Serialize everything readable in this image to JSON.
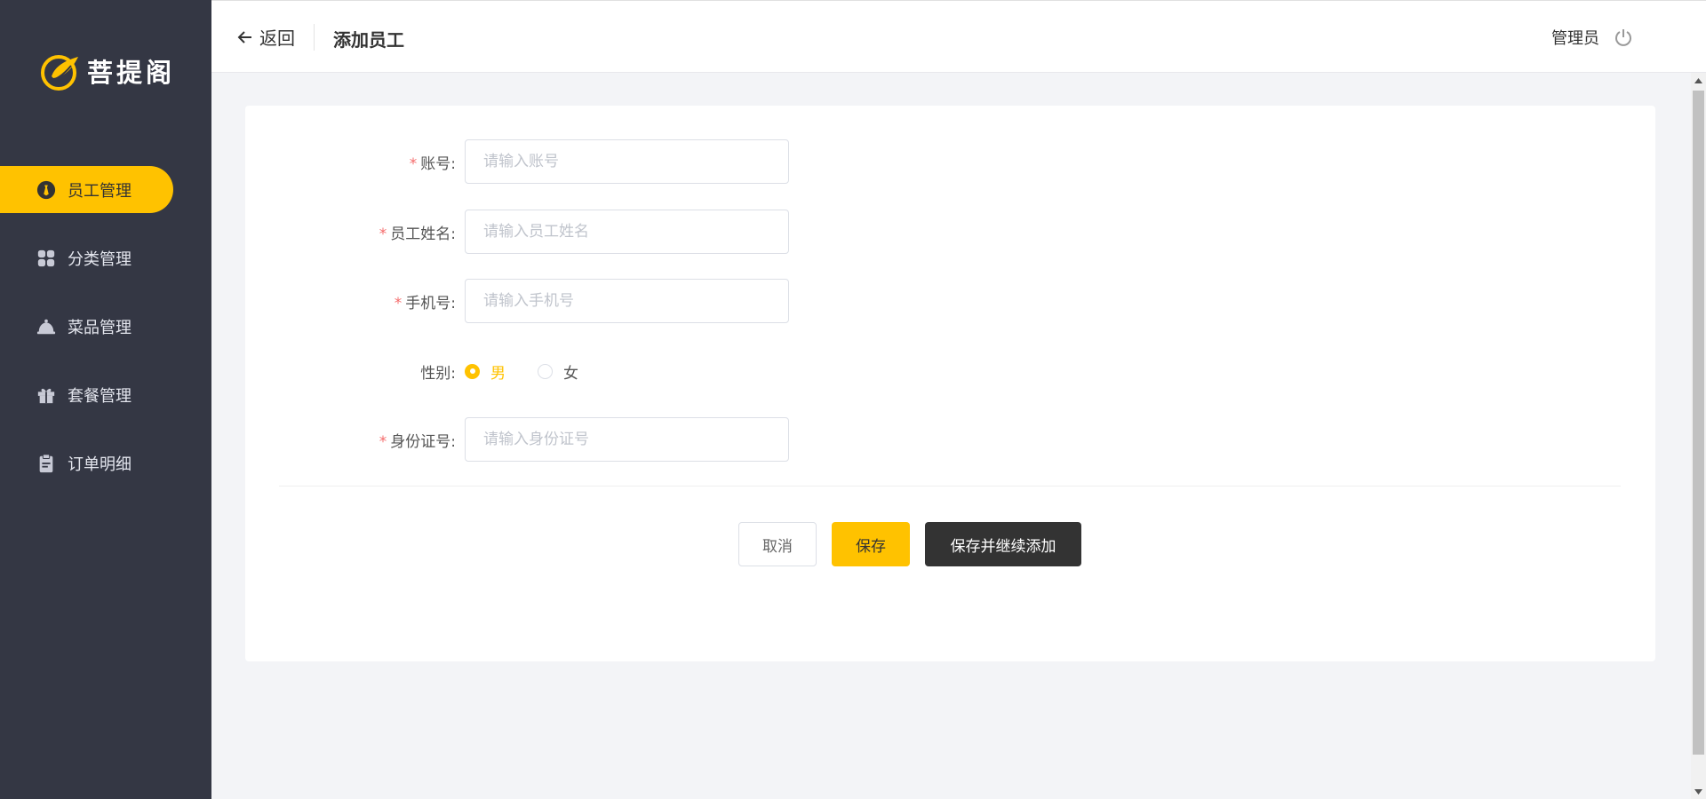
{
  "brand": {
    "name": "菩提阁"
  },
  "sidebar": {
    "items": [
      {
        "label": "员工管理",
        "icon": "employee-icon",
        "active": true
      },
      {
        "label": "分类管理",
        "icon": "category-grid-icon",
        "active": false
      },
      {
        "label": "菜品管理",
        "icon": "dish-cloche-icon",
        "active": false
      },
      {
        "label": "套餐管理",
        "icon": "gift-box-icon",
        "active": false
      },
      {
        "label": "订单明细",
        "icon": "clipboard-icon",
        "active": false
      }
    ]
  },
  "header": {
    "back_label": "返回",
    "title": "添加员工",
    "user_name": "管理员"
  },
  "form": {
    "account": {
      "label": "账号:",
      "placeholder": "请输入账号",
      "value": ""
    },
    "name": {
      "label": "员工姓名:",
      "placeholder": "请输入员工姓名",
      "value": ""
    },
    "phone": {
      "label": "手机号:",
      "placeholder": "请输入手机号",
      "value": ""
    },
    "gender": {
      "label": "性别:",
      "options": [
        "男",
        "女"
      ],
      "selected": "男"
    },
    "id_number": {
      "label": "身份证号:",
      "placeholder": "请输入身份证号",
      "value": ""
    },
    "required_mark": "*"
  },
  "buttons": {
    "cancel": "取消",
    "save": "保存",
    "save_continue": "保存并继续添加"
  },
  "colors": {
    "accent": "#ffc200",
    "sidebar_bg": "#343744",
    "dark_button": "#333333",
    "required": "#f56c6c"
  }
}
